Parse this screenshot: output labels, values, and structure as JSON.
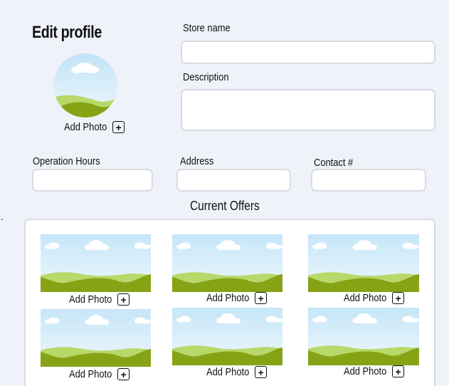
{
  "page": {
    "title": "Edit profile",
    "stray_mark": "."
  },
  "profile_photo": {
    "add_label": "Add Photo",
    "plus_glyph": "+",
    "icon": "landscape-placeholder-icon"
  },
  "fields": {
    "store_name": {
      "label": "Store name",
      "value": "",
      "placeholder": ""
    },
    "description": {
      "label": "Description",
      "value": "",
      "placeholder": ""
    },
    "operation_hours": {
      "label": "Operation Hours",
      "value": "",
      "placeholder": ""
    },
    "address": {
      "label": "Address",
      "value": "",
      "placeholder": ""
    },
    "contact": {
      "label": "Contact #",
      "value": "",
      "placeholder": ""
    }
  },
  "offers": {
    "title": "Current Offers",
    "items": [
      {
        "add_label": "Add Photo",
        "plus_glyph": "+",
        "icon": "landscape-placeholder-icon"
      },
      {
        "add_label": "Add Photo",
        "plus_glyph": "+",
        "icon": "landscape-placeholder-icon"
      },
      {
        "add_label": "Add Photo",
        "plus_glyph": "+",
        "icon": "landscape-placeholder-icon"
      },
      {
        "add_label": "Add Photo",
        "plus_glyph": "+",
        "icon": "landscape-placeholder-icon"
      },
      {
        "add_label": "Add Photo",
        "plus_glyph": "+",
        "icon": "landscape-placeholder-icon"
      },
      {
        "add_label": "Add Photo",
        "plus_glyph": "+",
        "icon": "landscape-placeholder-icon"
      }
    ]
  },
  "colors": {
    "page_bg": "#eff2f9",
    "field_border": "#d9dbe3",
    "sky_top": "#cde9f8",
    "hill_light": "#b9d86a",
    "hill_dark": "#86a316"
  }
}
